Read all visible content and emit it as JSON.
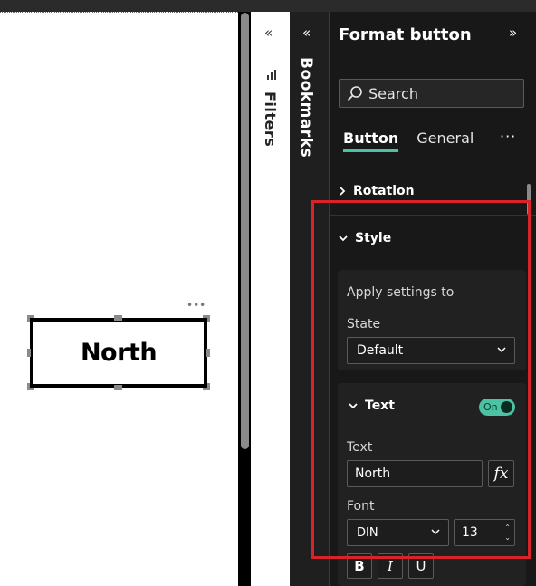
{
  "canvas": {
    "button_text": "North",
    "more_label": "•••"
  },
  "filters": {
    "collapse_glyph": "«",
    "label": "Filters"
  },
  "bookmarks": {
    "collapse_glyph": "«",
    "label": "Bookmarks"
  },
  "format_pane": {
    "title": "Format button",
    "expand_glyph": "»",
    "search_placeholder": "Search",
    "tabs": [
      {
        "label": "Button",
        "active": true
      },
      {
        "label": "General",
        "active": false
      }
    ],
    "more_label": "···",
    "sections": {
      "rotation": {
        "label": "Rotation",
        "expanded": false
      },
      "style": {
        "label": "Style",
        "expanded": true
      }
    },
    "apply_settings": {
      "heading": "Apply settings to",
      "state_label": "State",
      "state_value": "Default"
    },
    "text_section": {
      "label": "Text",
      "toggle_label": "On",
      "toggle_on": true,
      "text_label": "Text",
      "text_value": "North",
      "fx_label": "fx",
      "font_label": "Font",
      "font_value": "DIN",
      "size_value": "13",
      "bold_label": "B",
      "italic_label": "I",
      "underline_label": "U"
    }
  },
  "colors": {
    "accent": "#4cc2a4",
    "highlight": "#d8232a",
    "pane_bg": "#181818"
  }
}
